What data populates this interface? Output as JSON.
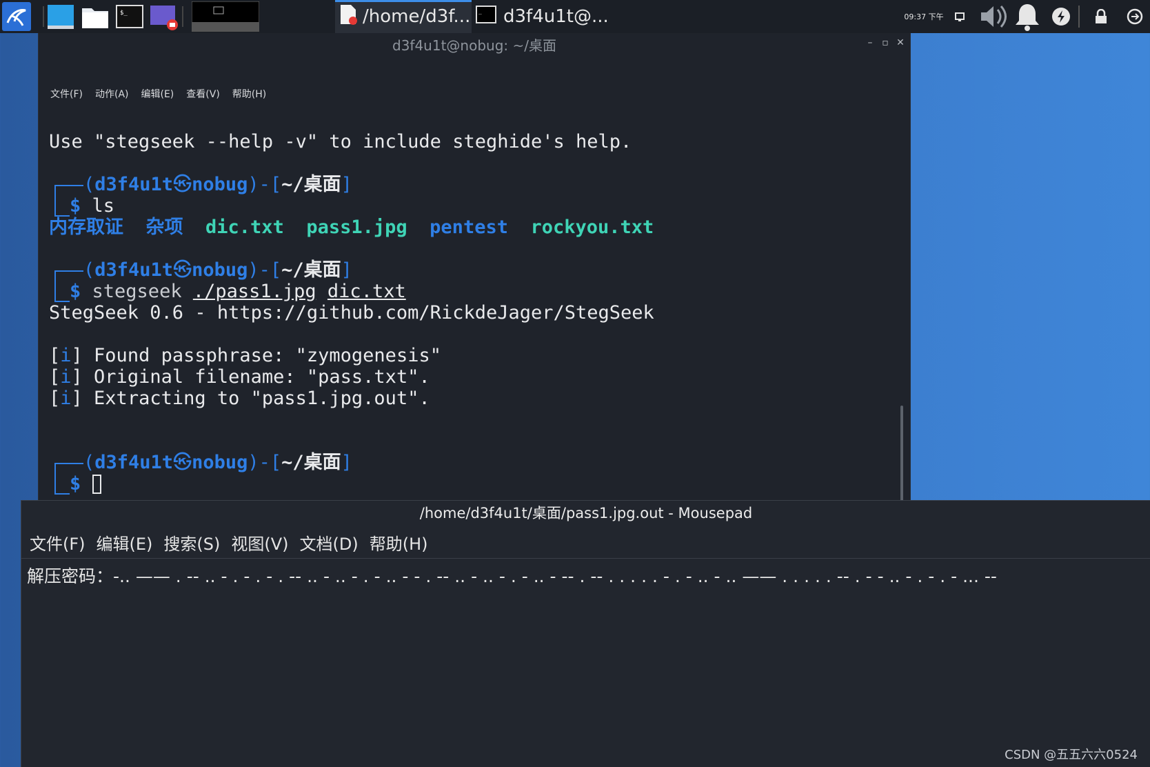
{
  "panel": {
    "tasks": [
      {
        "label": "/home/d3f..."
      },
      {
        "label": "d3f4u1t@..."
      }
    ],
    "clock": "09:37 下午"
  },
  "terminal": {
    "title": "d3f4u1t@nobug: ~/桌面",
    "menu": [
      "文件(F)",
      "动作(A)",
      "编辑(E)",
      "查看(V)",
      "帮助(H)"
    ],
    "help_line": "Use \"stegseek --help -v\" to include steghide's help.",
    "prompt": {
      "user": "d3f4u1t",
      "host": "nobug",
      "path": "~/桌面",
      "symbol": "$"
    },
    "cmd1": "ls",
    "ls_output": [
      {
        "name": "内存取证",
        "kind": "dir"
      },
      {
        "name": "杂项",
        "kind": "dir"
      },
      {
        "name": "dic.txt",
        "kind": "file"
      },
      {
        "name": "pass1.jpg",
        "kind": "file"
      },
      {
        "name": "pentest",
        "kind": "dir"
      },
      {
        "name": "rockyou.txt",
        "kind": "file"
      }
    ],
    "cmd2": {
      "prog": "stegseek",
      "arg1": "./pass1.jpg",
      "arg2": "dic.txt"
    },
    "stegseek_banner": "StegSeek 0.6 - https://github.com/RickdeJager/StegSeek",
    "info_tag": "i",
    "info_lines": [
      "Found passphrase: \"zymogenesis\"",
      "Original filename: \"pass.txt\".",
      "Extracting to \"pass1.jpg.out\"."
    ]
  },
  "mousepad": {
    "title": "/home/d3f4u1t/桌面/pass1.jpg.out - Mousepad",
    "menu": [
      "文件(F)",
      "编辑(E)",
      "搜索(S)",
      "视图(V)",
      "文档(D)",
      "帮助(H)"
    ],
    "content": "解压密码：-.. —— . -- .. - . - .  - . -- .. - .. - . - .. -  - . -- .. - .. - . - .. -  -- . -- . . . . . - . - ..  - .. —— . . . . . -- . -  - .. - . - . - ... --"
  },
  "watermark": "CSDN @五五六六0524"
}
